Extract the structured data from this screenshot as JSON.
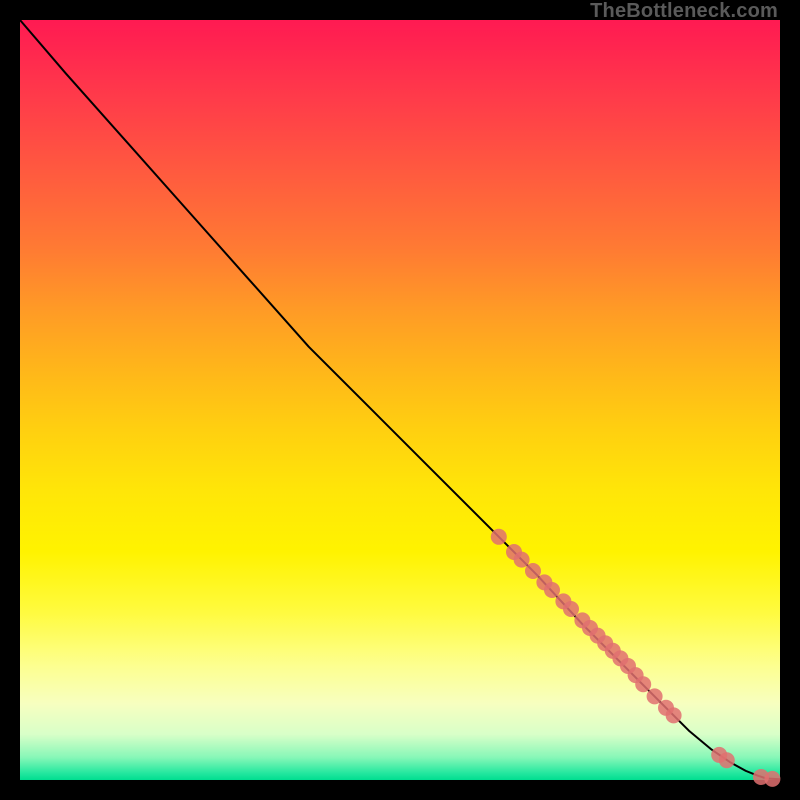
{
  "watermark": "TheBottleneck.com",
  "chart_data": {
    "type": "line",
    "title": "",
    "xlabel": "",
    "ylabel": "",
    "xlim": [
      0,
      100
    ],
    "ylim": [
      0,
      100
    ],
    "grid": false,
    "legend": false,
    "series": [
      {
        "name": "curve",
        "stroke": "#000000",
        "x": [
          0,
          6,
          14,
          22,
          30,
          38,
          46,
          54,
          62,
          68,
          74,
          80,
          85,
          88,
          91,
          93.5,
          95.5,
          97,
          98.2,
          100
        ],
        "y": [
          100,
          93,
          84,
          75,
          66,
          57,
          49,
          41,
          33,
          27,
          20.5,
          14.5,
          9.5,
          6.5,
          4,
          2.3,
          1.2,
          0.6,
          0.2,
          0.1
        ]
      },
      {
        "name": "dots",
        "color": "#e07070",
        "x": [
          63,
          65,
          66,
          67.5,
          69,
          70,
          71.5,
          72.5,
          74,
          75,
          76,
          77,
          78,
          79,
          80,
          81,
          82,
          83.5,
          85,
          86,
          92,
          93,
          97.5,
          99
        ],
        "y": [
          32,
          30,
          29,
          27.5,
          26,
          25,
          23.5,
          22.5,
          21,
          20,
          19,
          18,
          17,
          16,
          15,
          13.8,
          12.6,
          11,
          9.5,
          8.5,
          3.3,
          2.6,
          0.4,
          0.15
        ]
      }
    ]
  }
}
